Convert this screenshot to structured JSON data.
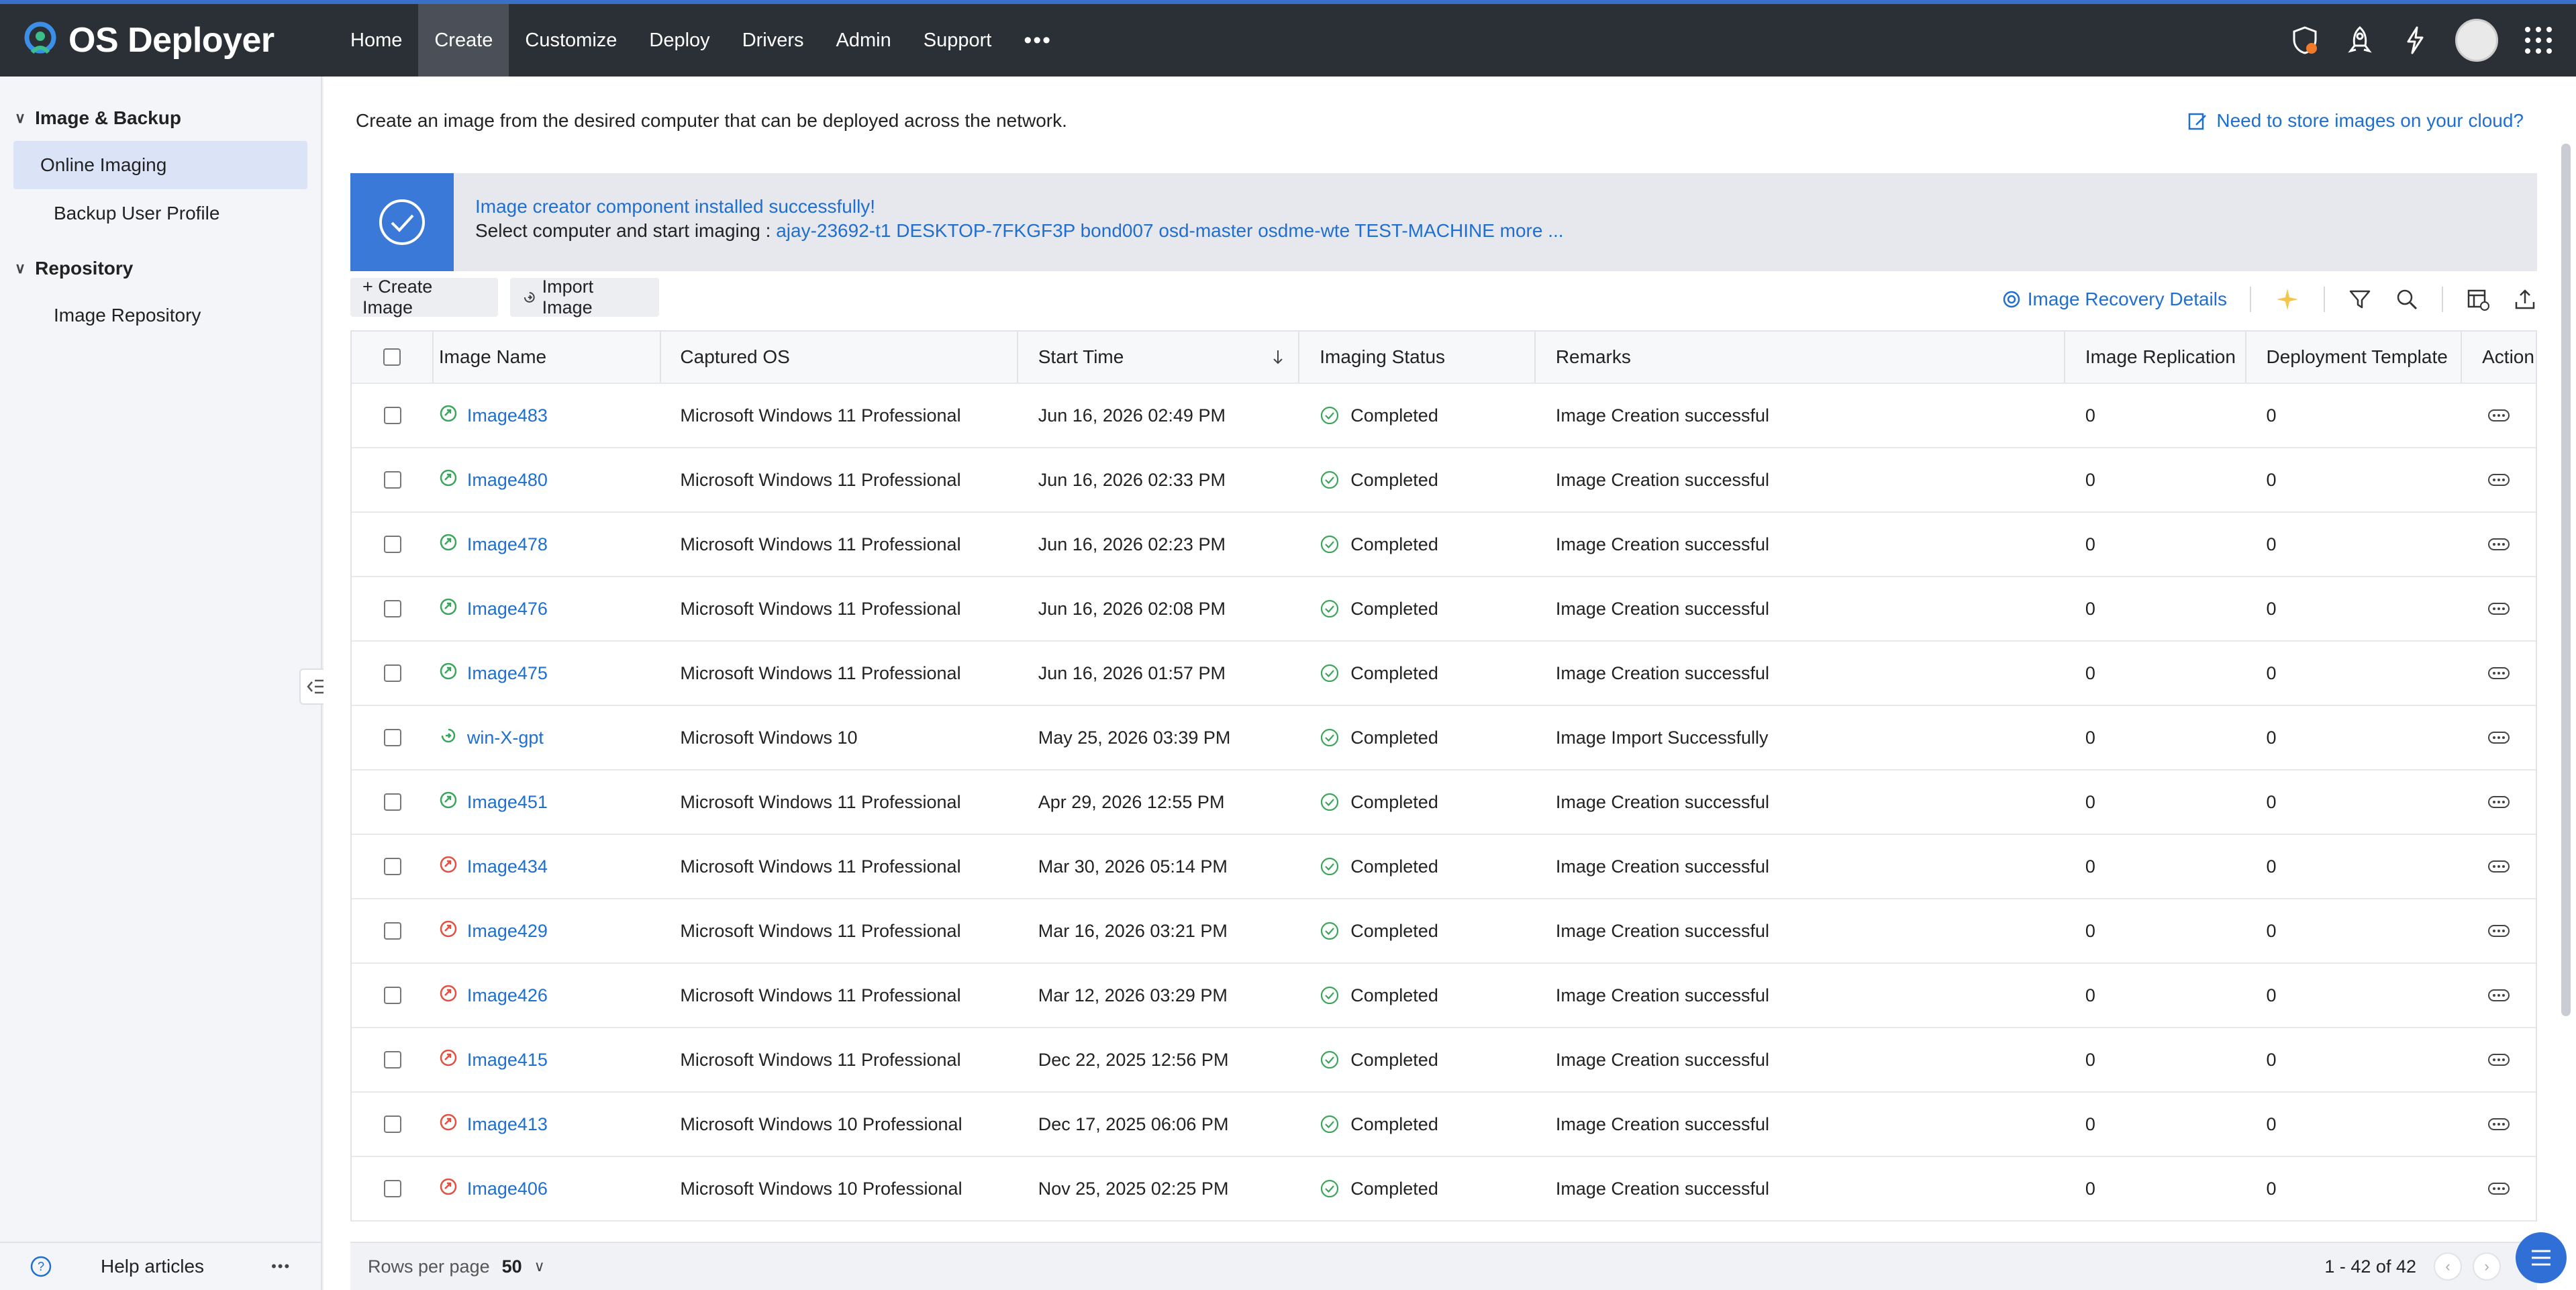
{
  "app": {
    "name": "OS Deployer"
  },
  "nav": [
    "Home",
    "Create",
    "Customize",
    "Deploy",
    "Drivers",
    "Admin",
    "Support"
  ],
  "nav_active": "Create",
  "nav_more": "•••",
  "sidebar": {
    "groups": [
      {
        "label": "Image & Backup",
        "items": [
          "Online Imaging",
          "Backup User Profile"
        ]
      },
      {
        "label": "Repository",
        "items": [
          "Image Repository"
        ]
      }
    ],
    "active_item": "Online Imaging",
    "help": "Help articles",
    "more": "•••"
  },
  "main": {
    "description": "Create an image from the desired computer that can be deployed across the network.",
    "cloud_link": "Need to store images on your cloud?",
    "banner": {
      "title": "Image creator component installed successfully!",
      "prefix": "Select computer and start imaging : ",
      "hosts": "ajay-23692-t1 DESKTOP-7FKGF3P bond007 osd-master osdme-wte TEST-MACHINE more ..."
    },
    "toolbar": {
      "create": "+ Create Image",
      "import": "Import Image",
      "recovery": "Image Recovery Details"
    }
  },
  "table": {
    "headers": [
      "Image Name",
      "Captured OS",
      "Start Time",
      "Imaging Status",
      "Remarks",
      "Image Replication",
      "Deployment Template",
      "Action"
    ],
    "rows": [
      {
        "name": "Image483",
        "icon": "green",
        "os": "Microsoft Windows 11 Professional",
        "time": "Jun 16, 2026 02:49 PM",
        "status": "Completed",
        "remarks": "Image Creation successful",
        "repl": "0",
        "tmpl": "0"
      },
      {
        "name": "Image480",
        "icon": "green",
        "os": "Microsoft Windows 11 Professional",
        "time": "Jun 16, 2026 02:33 PM",
        "status": "Completed",
        "remarks": "Image Creation successful",
        "repl": "0",
        "tmpl": "0"
      },
      {
        "name": "Image478",
        "icon": "green",
        "os": "Microsoft Windows 11 Professional",
        "time": "Jun 16, 2026 02:23 PM",
        "status": "Completed",
        "remarks": "Image Creation successful",
        "repl": "0",
        "tmpl": "0"
      },
      {
        "name": "Image476",
        "icon": "green",
        "os": "Microsoft Windows 11 Professional",
        "time": "Jun 16, 2026 02:08 PM",
        "status": "Completed",
        "remarks": "Image Creation successful",
        "repl": "0",
        "tmpl": "0"
      },
      {
        "name": "Image475",
        "icon": "green",
        "os": "Microsoft Windows 11 Professional",
        "time": "Jun 16, 2026 01:57 PM",
        "status": "Completed",
        "remarks": "Image Creation successful",
        "repl": "0",
        "tmpl": "0"
      },
      {
        "name": "win-X-gpt",
        "icon": "import",
        "os": "Microsoft Windows 10",
        "time": "May 25, 2026 03:39 PM",
        "status": "Completed",
        "remarks": "Image Import Successfully",
        "repl": "0",
        "tmpl": "0"
      },
      {
        "name": "Image451",
        "icon": "green",
        "os": "Microsoft Windows 11 Professional",
        "time": "Apr 29, 2026 12:55 PM",
        "status": "Completed",
        "remarks": "Image Creation successful",
        "repl": "0",
        "tmpl": "0"
      },
      {
        "name": "Image434",
        "icon": "red",
        "os": "Microsoft Windows 11 Professional",
        "time": "Mar 30, 2026 05:14 PM",
        "status": "Completed",
        "remarks": "Image Creation successful",
        "repl": "0",
        "tmpl": "0"
      },
      {
        "name": "Image429",
        "icon": "red",
        "os": "Microsoft Windows 11 Professional",
        "time": "Mar 16, 2026 03:21 PM",
        "status": "Completed",
        "remarks": "Image Creation successful",
        "repl": "0",
        "tmpl": "0"
      },
      {
        "name": "Image426",
        "icon": "red",
        "os": "Microsoft Windows 11 Professional",
        "time": "Mar 12, 2026 03:29 PM",
        "status": "Completed",
        "remarks": "Image Creation successful",
        "repl": "0",
        "tmpl": "0"
      },
      {
        "name": "Image415",
        "icon": "red",
        "os": "Microsoft Windows 11 Professional",
        "time": "Dec 22, 2025 12:56 PM",
        "status": "Completed",
        "remarks": "Image Creation successful",
        "repl": "0",
        "tmpl": "0"
      },
      {
        "name": "Image413",
        "icon": "red",
        "os": "Microsoft Windows 10 Professional",
        "time": "Dec 17, 2025 06:06 PM",
        "status": "Completed",
        "remarks": "Image Creation successful",
        "repl": "0",
        "tmpl": "0"
      },
      {
        "name": "Image406",
        "icon": "red",
        "os": "Microsoft Windows 10 Professional",
        "time": "Nov 25, 2025 02:25 PM",
        "status": "Completed",
        "remarks": "Image Creation successful",
        "repl": "0",
        "tmpl": "0"
      }
    ]
  },
  "footer": {
    "rows_label": "Rows per page",
    "rows_value": "50",
    "count": "1 - 42 of 42"
  },
  "colors": {
    "accent": "#1f6fd1",
    "banner_check": "#3b79d8",
    "topbar": "#2b2f36",
    "green": "#3aa55c",
    "red": "#e0523f"
  }
}
